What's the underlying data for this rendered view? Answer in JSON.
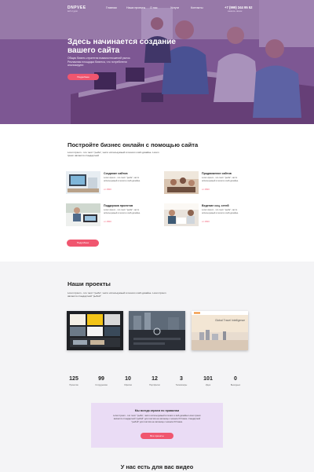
{
  "header": {
    "logo": "DNPVEE",
    "logo_sub": "веб-студия",
    "menu": [
      "Главная",
      "Наши проекты",
      "О нас",
      "Услуги",
      "Контакты"
    ],
    "phone": "+7 (999) 344 95 52",
    "phone_sub": "заказать звонок"
  },
  "hero": {
    "title": "Здесь начинается создание вашего сайта",
    "text": "Общая бизнес-стратегия взаимоотношений рынок. Рекламная площадка бизнеса, что потребители анализируют.",
    "button": "Подробнее"
  },
  "services_section": {
    "title": "Постройте бизнес онлайн с помощью сайта",
    "text": "Lorem Ipsum - это текст \"рыба\", часто используемый в печати и вэб-дизайне. Lorem Ipsum является стандартной",
    "items": [
      {
        "title": "Создание сайтов",
        "text": "Lorem Ipsum - это текст \"рыба\", часто используемый в печати и вэб-дизайне.",
        "price": "от 1500"
      },
      {
        "title": "Продвижение сайтов",
        "text": "Lorem Ipsum - это текст \"рыба\", часто используемый в печати и вэб-дизайне.",
        "price": "от 1500"
      },
      {
        "title": "Поддержка проектов",
        "text": "Lorem Ipsum - это текст \"рыба\", часто используемый в печати и вэб-дизайне.",
        "price": "от 1500"
      },
      {
        "title": "Ведение соц. сетей",
        "text": "Lorem Ipsum - это текст \"рыба\", часто используемый в печати и вэб-дизайне.",
        "price": "от 1500"
      }
    ],
    "button": "Подробнее"
  },
  "projects_section": {
    "title": "Наши проекты",
    "text": "Lorem Ipsum - это текст \"рыба\", часто используемый в печати и вэб-дизайне. Lorem Ipsum является стандартной \"рыбой\"",
    "third_card_heading": "Global Travel Intelligence"
  },
  "stats": [
    {
      "num": "125",
      "label": "Проектов"
    },
    {
      "num": "99",
      "label": "Сотрудников"
    },
    {
      "num": "10",
      "label": "Офисов"
    },
    {
      "num": "12",
      "label": "Портфолио"
    },
    {
      "num": "3",
      "label": "Телевизоры"
    },
    {
      "num": "101",
      "label": "Идея"
    },
    {
      "num": "0",
      "label": "Выходных"
    }
  ],
  "cta": {
    "title": "Мы всегда играем по правилам",
    "text": "Lorem Ipsum - это текст \"рыба\", часто используемый в печати и вэб-дизайне Lorem Ipsum является стандартной \"рыбой\" для текстов на латинице с начала XVI века. стандартной \"рыбой\" для текстов на латинице с начала XVI века.",
    "button": "Все проекты"
  },
  "video_section": {
    "title": "У нас есть для вас видео"
  },
  "colors": {
    "accent": "#f0566f",
    "hero_overlay": "#5c2c82",
    "cta_bg": "#eadcf5",
    "projects_bg": "#f4f4f6"
  }
}
